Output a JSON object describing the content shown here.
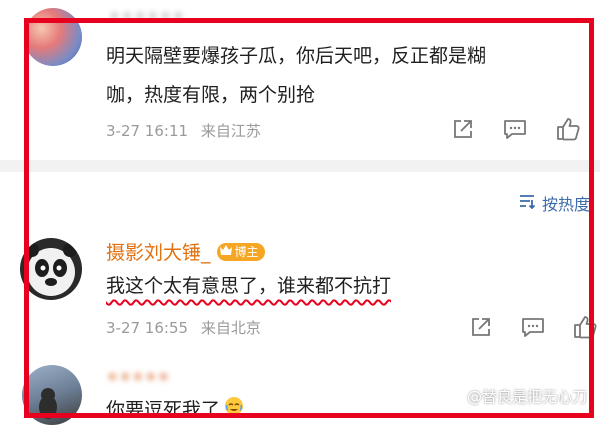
{
  "comments": [
    {
      "username": "••••••",
      "text_line1": "明天隔壁要爆孩子瓜，你后天吧，反正都是糊",
      "text_line2": "咖，热度有限，两个别抢",
      "time": "3-27 16:11",
      "location": "来自江苏"
    },
    {
      "username": "摄影刘大锤_",
      "badge": "博主",
      "text": "我这个太有意思了，谁来都不抗打",
      "time": "3-27 16:55",
      "location": "来自北京"
    },
    {
      "username": "•••••",
      "text": "你要逗死我了"
    }
  ],
  "sort": {
    "label": "按热度"
  },
  "watermark": "@替良是把无心刀",
  "colors": {
    "accent_red": "#e8001f",
    "username_orange": "#e2710e",
    "sort_blue": "#3d6ba8"
  },
  "icons": [
    "share-icon",
    "comment-icon",
    "like-icon",
    "sort-icon",
    "emoji-icon"
  ]
}
